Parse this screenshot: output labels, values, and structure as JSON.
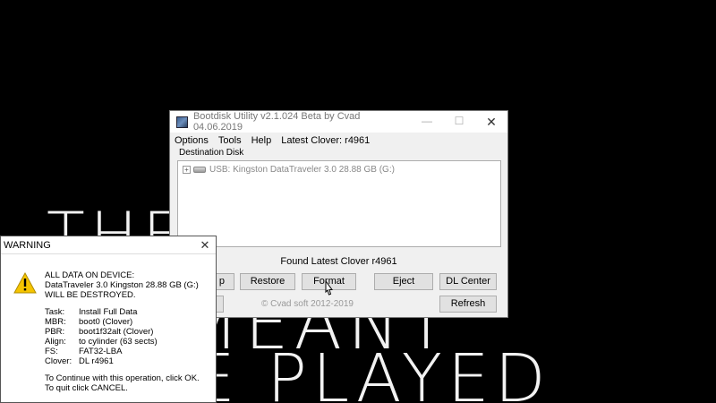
{
  "background": {
    "line1": "THE",
    "line2": "MEANT",
    "line3": "E PLAYED"
  },
  "window": {
    "title": "Bootdisk Utility v2.1.024 Beta by Cvad 04.06.2019",
    "controls": {
      "minimize": "—",
      "maximize": "☐",
      "close": "✕"
    },
    "menu": [
      "Options",
      "Tools",
      "Help",
      "Latest Clover: r4961"
    ],
    "destination_label": "Destination Disk",
    "disk_entry": "USB: Kingston DataTraveler 3.0 28.88 GB (G:)",
    "status": "Found Latest Clover r4961",
    "buttons": {
      "backup_partial": "p",
      "restore": "Restore",
      "format": "Format",
      "eject": "Eject",
      "dl_center": "DL Center",
      "refresh": "Refresh"
    },
    "copyright": "© Cvad soft 2012-2019"
  },
  "warning": {
    "title": "WARNING",
    "close": "✕",
    "lines": [
      "ALL DATA ON DEVICE:",
      "DataTraveler 3.0 Kingston 28.88 GB (G:)",
      "WILL BE DESTROYED."
    ],
    "details": [
      {
        "k": "Task:",
        "v": "Install Full Data"
      },
      {
        "k": "MBR:",
        "v": "boot0 (Clover)"
      },
      {
        "k": "PBR:",
        "v": "boot1f32alt (Clover)"
      },
      {
        "k": "Align:",
        "v": "to cylinder (63 sects)"
      },
      {
        "k": "FS:",
        "v": "FAT32-LBA"
      },
      {
        "k": "Clover:",
        "v": "DL r4961"
      }
    ],
    "footer": [
      "To Continue with this operation, click OK.",
      "To quit click CANCEL."
    ]
  },
  "colors": {
    "background": "#000000",
    "window": "#f0f0f0",
    "warning_icon": "#f5c400"
  }
}
